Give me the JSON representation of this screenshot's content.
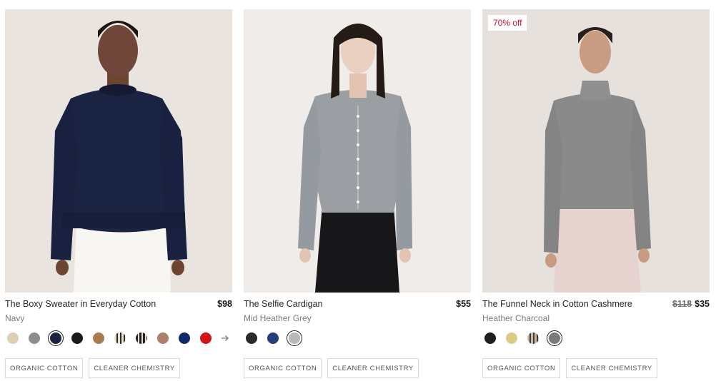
{
  "products": [
    {
      "title": "The Boxy Sweater in Everyday Cotton",
      "price": "$98",
      "color_name": "Navy",
      "swatches": [
        {
          "name": "oat-swatch",
          "color": "#dccfb4"
        },
        {
          "name": "grey-swatch",
          "color": "#8e8e8e"
        },
        {
          "name": "navy-swatch",
          "color": "#1c2340",
          "selected": true
        },
        {
          "name": "black-swatch",
          "color": "#1a1a1a"
        },
        {
          "name": "camel-swatch",
          "color": "#a87c4f"
        },
        {
          "name": "stripe-cream-swatch",
          "color": "#e8e0cf",
          "stripe": "#2a2a2a"
        },
        {
          "name": "stripe-black-swatch",
          "color": "#222222",
          "stripe": "#e5dfd1"
        },
        {
          "name": "rose-brown-swatch",
          "color": "#b07e6c"
        },
        {
          "name": "royal-navy-swatch",
          "color": "#0f2a6b"
        },
        {
          "name": "red-swatch",
          "color": "#d31414"
        }
      ],
      "more_icon": "arrow-right-icon",
      "tags": [
        "Organic Cotton",
        "Cleaner Chemistry"
      ]
    },
    {
      "title": "The Selfie Cardigan",
      "price": "$55",
      "color_name": "Mid Heather Grey",
      "swatches": [
        {
          "name": "black-swatch",
          "color": "#2a2a2a"
        },
        {
          "name": "navy-swatch",
          "color": "#253e7a"
        },
        {
          "name": "heather-grey-swatch",
          "color": "#b9b9b9",
          "selected": true
        }
      ],
      "tags": [
        "Organic Cotton",
        "Cleaner Chemistry"
      ]
    },
    {
      "badge": "70% off",
      "title": "The Funnel Neck in Cotton Cashmere",
      "old_price": "$118",
      "price": "$35",
      "color_name": "Heather Charcoal",
      "swatches": [
        {
          "name": "black-swatch",
          "color": "#1f1f1f"
        },
        {
          "name": "wheat-swatch",
          "color": "#dccb86"
        },
        {
          "name": "stripe-swatch",
          "color": "#cdb9a3",
          "stripe": "#3b3b3b"
        },
        {
          "name": "heather-charcoal-swatch",
          "color": "#7b7b7b",
          "selected": true
        }
      ],
      "tags": [
        "Organic Cotton",
        "Cleaner Chemistry"
      ]
    }
  ]
}
